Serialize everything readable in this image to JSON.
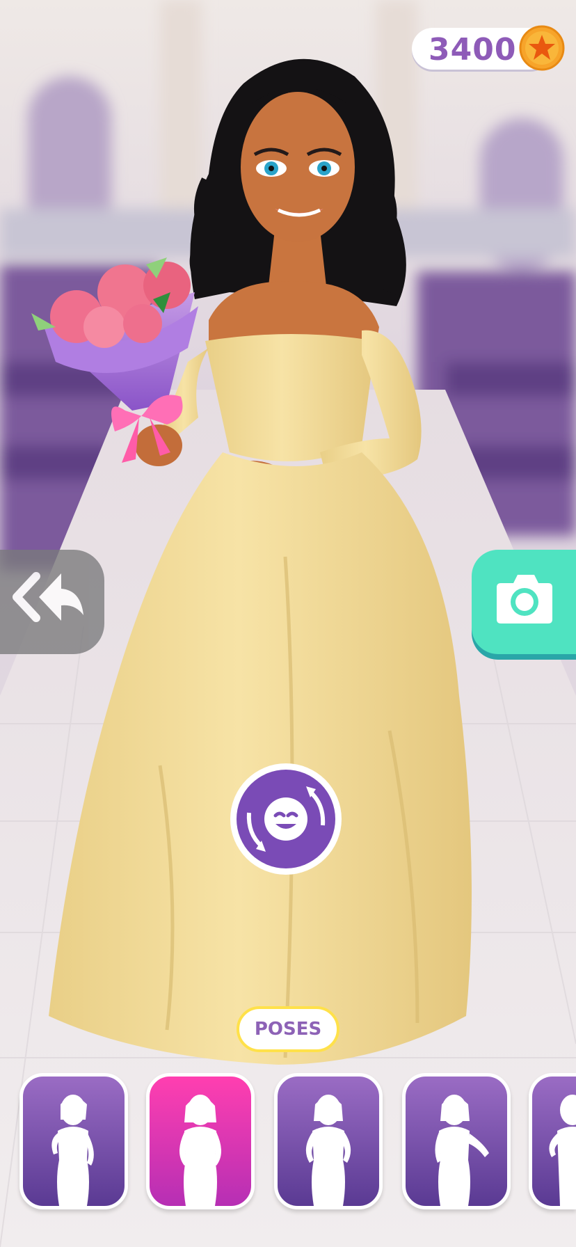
{
  "hud": {
    "coins": "3400",
    "coin_icon": "star-coin-icon"
  },
  "controls": {
    "back_icon": "double-back-arrow-icon",
    "camera_icon": "camera-icon",
    "emote_icon": "rotate-face-icon"
  },
  "poses": {
    "label": "POSES",
    "selected_index": 1,
    "items": [
      {
        "icon": "pose-silhouette-icon"
      },
      {
        "icon": "pose-silhouette-icon"
      },
      {
        "icon": "pose-silhouette-icon"
      },
      {
        "icon": "pose-silhouette-icon"
      },
      {
        "icon": "pose-silhouette-icon"
      }
    ]
  },
  "colors": {
    "coin_text": "#8e5bb8",
    "camera_button": "#4fe3c1",
    "pose_card": "#6f48a8",
    "pose_card_selected": "#e33db4",
    "poses_label_border": "#ffe14a",
    "gown": "#f4dc98"
  }
}
